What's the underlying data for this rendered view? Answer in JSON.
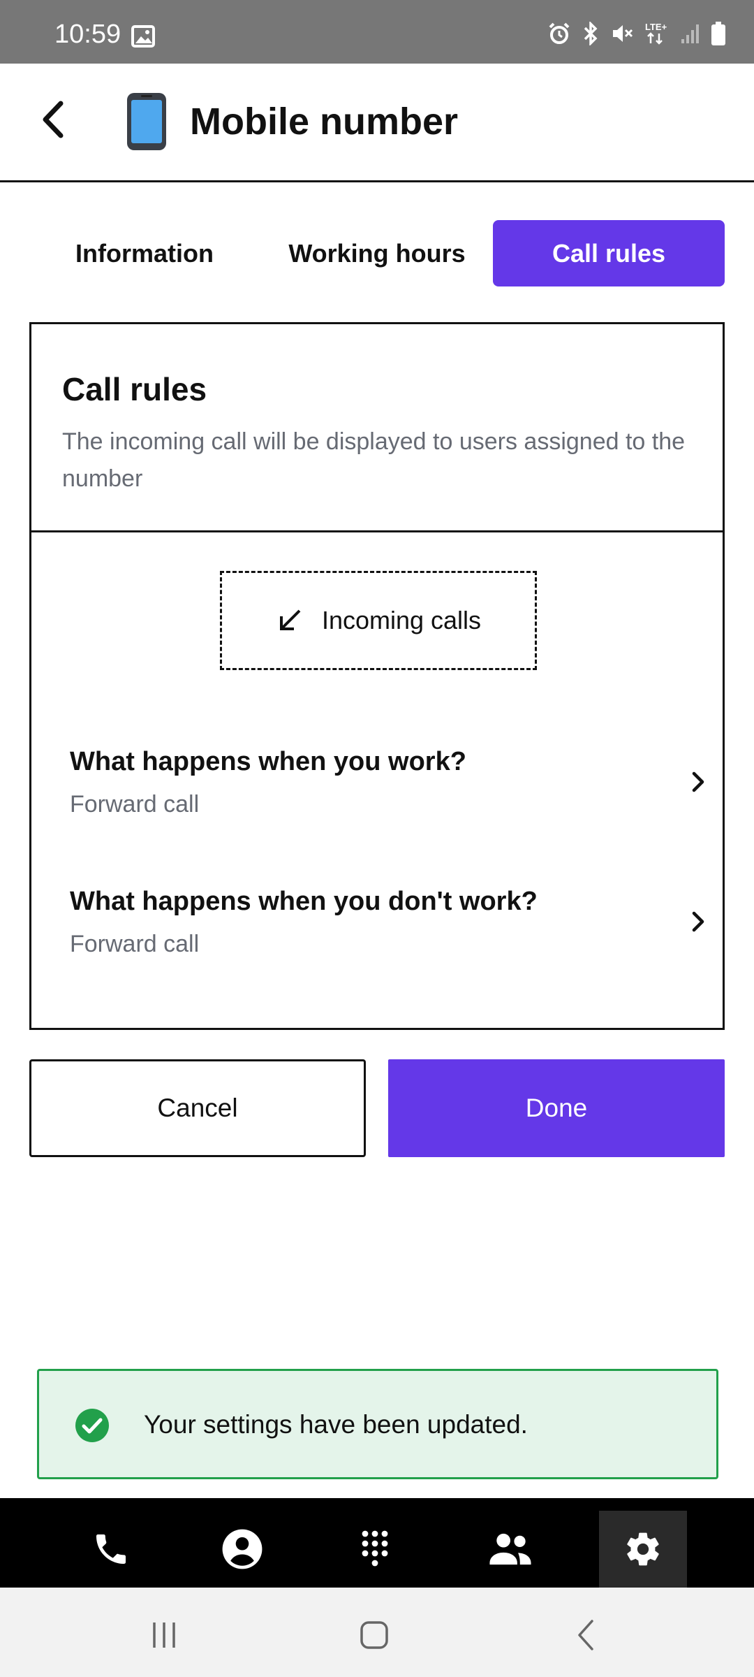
{
  "status_bar": {
    "time": "10:59",
    "icons": [
      "image-icon",
      "alarm-icon",
      "bluetooth-icon",
      "mute-icon",
      "lte-icon",
      "signal-icon",
      "battery-icon"
    ],
    "lte_label": "LTE+"
  },
  "header": {
    "title": "Mobile number",
    "back_icon": "chevron-left-icon",
    "device_icon": "mobile-phone-icon"
  },
  "tabs": [
    {
      "label": "Information",
      "active": false
    },
    {
      "label": "Working hours",
      "active": false
    },
    {
      "label": "Call rules",
      "active": true
    }
  ],
  "card": {
    "title": "Call rules",
    "description": "The incoming call will be displayed to users assigned to the number",
    "incoming_label": "Incoming calls",
    "rules": [
      {
        "title": "What happens when you work?",
        "subtitle": "Forward call"
      },
      {
        "title": "What happens when you don't work?",
        "subtitle": "Forward call"
      }
    ]
  },
  "actions": {
    "cancel_label": "Cancel",
    "done_label": "Done"
  },
  "toast": {
    "message": "Your settings have been updated."
  },
  "bottom_nav": {
    "items": [
      "phone-icon",
      "contact-icon",
      "dialpad-icon",
      "team-icon",
      "settings-icon"
    ],
    "active": "settings-icon"
  },
  "colors": {
    "accent": "#6438E8",
    "success": "#22A04B",
    "toast_bg": "#E4F4EA",
    "muted_text": "#666a73"
  }
}
